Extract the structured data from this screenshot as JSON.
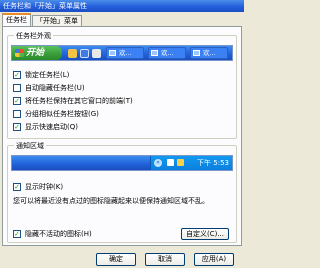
{
  "window": {
    "title": "任务栏和「开始」菜单属性"
  },
  "tabs": [
    {
      "label": "任务栏"
    },
    {
      "label": "「开始」菜单"
    }
  ],
  "appearance": {
    "title": "任务栏外观",
    "start_label": "开始",
    "task_button_label": "欢...",
    "options": [
      {
        "label": "锁定任务栏(L)",
        "checked": true
      },
      {
        "label": "自动隐藏任务栏(U)",
        "checked": false
      },
      {
        "label": "将任务栏保持在其它窗口的前端(T)",
        "checked": true
      },
      {
        "label": "分组相似任务栏按钮(G)",
        "checked": false
      },
      {
        "label": "显示快速启动(Q)",
        "checked": true
      }
    ]
  },
  "notification": {
    "title": "通知区域",
    "time": "下午 5:53",
    "show_clock": {
      "label": "显示时钟(K)",
      "checked": true
    },
    "description": "您可以将最近没有点过的图标隐藏起来以便保持通知区域不乱。",
    "hide_inactive": {
      "label": "隐藏不活动的图标(H)",
      "checked": true
    },
    "customize_label": "自定义(C)..."
  },
  "buttons": {
    "ok": "确定",
    "cancel": "取消",
    "apply": "应用(A)"
  },
  "check_mark": "✓"
}
